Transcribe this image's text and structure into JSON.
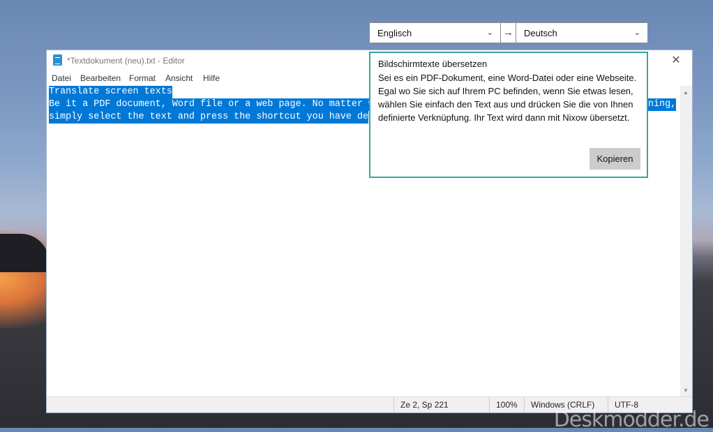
{
  "notepad": {
    "title": "*Textdokument (neu).txt - Editor",
    "menu": [
      "Datei",
      "Bearbeiten",
      "Format",
      "Ansicht",
      "Hilfe"
    ],
    "lines": [
      "Translate screen texts",
      "Be it a PDF document, Word file or a web page. No matter w",
      "simply select the text and press the shortcut you have de"
    ],
    "line2_tail": "ning,",
    "status": {
      "position": "Ze 2, Sp 221",
      "zoom": "100%",
      "line_ending": "Windows (CRLF)",
      "encoding": "UTF-8"
    },
    "close_symbol": "✕"
  },
  "translator": {
    "source_lang": "Englisch",
    "target_lang": "Deutsch",
    "arrow": "→",
    "title": "Bildschirmtexte übersetzen",
    "text": "Sei es ein PDF-Dokument, eine Word-Datei oder eine Webseite. Egal wo Sie sich auf Ihrem PC befinden, wenn Sie etwas lesen, wählen Sie einfach den Text aus und drücken Sie die von Ihnen definierte Verknüpfung. Ihr Text wird dann mit Nixow übersetzt.",
    "copy_label": "Kopieren"
  },
  "watermark": "Deskmodder.de"
}
